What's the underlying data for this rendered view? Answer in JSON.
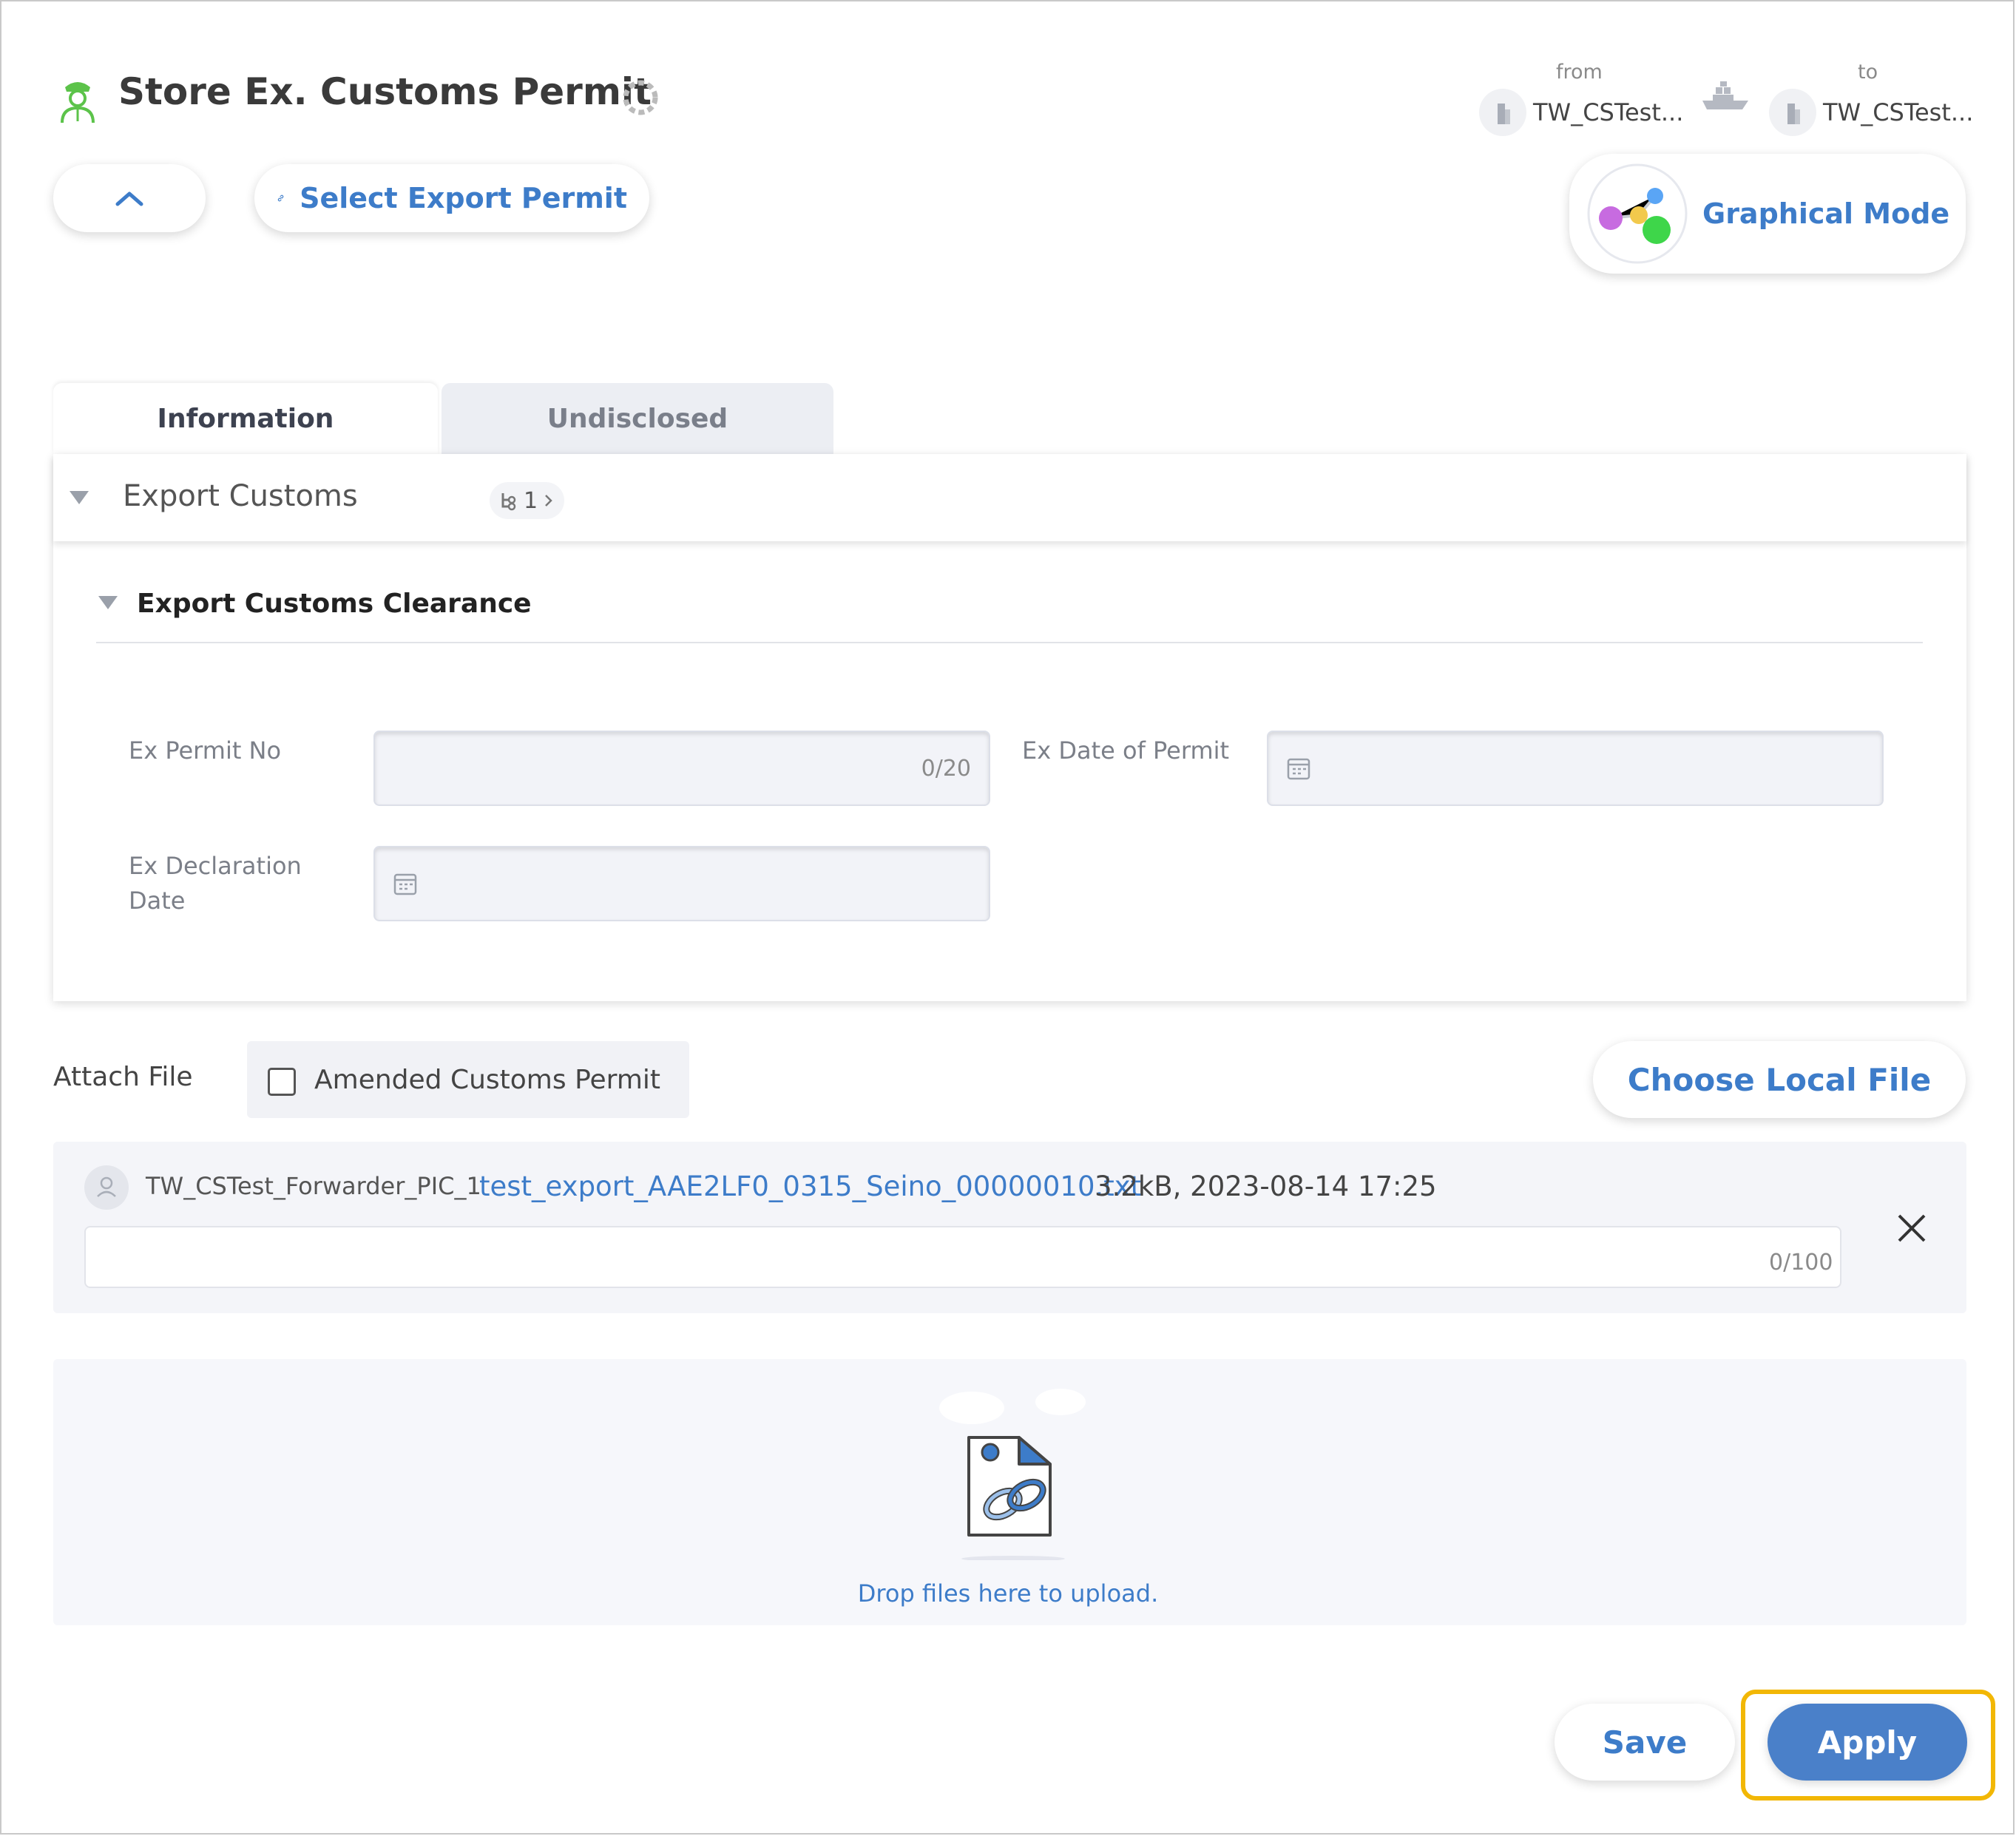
{
  "header": {
    "title": "Store Ex. Customs Permit",
    "route": {
      "from_label": "from",
      "from_name": "TW_CSTest...",
      "to_label": "to",
      "to_name": "TW_CSTest..."
    }
  },
  "toolbar": {
    "select_export_permit": "Select Export Permit",
    "graphical_mode": "Graphical Mode"
  },
  "tabs": [
    {
      "label": "Information",
      "active": true
    },
    {
      "label": "Undisclosed",
      "active": false
    }
  ],
  "section": {
    "title": "Export Customs",
    "badge_count": "1",
    "subsection_title": "Export Customs Clearance"
  },
  "fields": {
    "ex_permit_no": {
      "label": "Ex Permit No",
      "value": "",
      "counter": "0/20"
    },
    "ex_date_of_permit": {
      "label": "Ex Date of Permit",
      "value": ""
    },
    "ex_declaration_date": {
      "label_line1": "Ex Declaration",
      "label_line2": "Date",
      "value": ""
    }
  },
  "attachments": {
    "label": "Attach File",
    "amended_checkbox_label": "Amended Customs Permit",
    "amended_checked": false,
    "choose_local_file": "Choose Local File",
    "files": [
      {
        "uploader": "TW_CSTest_Forwarder_PIC_1",
        "filename": "test_export_AAE2LF0_0315_Seino_00000010.txt",
        "info": "3.2kB, 2023-08-14 17:25",
        "comment": "",
        "comment_counter": "0/100"
      }
    ],
    "drop_text": "Drop files here to upload."
  },
  "footer": {
    "save": "Save",
    "apply": "Apply"
  },
  "colors": {
    "accent": "#3d7cc9",
    "highlight": "#f2b705",
    "officer_icon": "#5cc34a"
  },
  "icons": [
    "customs-officer-icon",
    "loading-spinner-icon",
    "building-icon",
    "ship-icon",
    "chevron-up-icon",
    "link-icon",
    "graph-nodes-icon",
    "caret-down-icon",
    "hierarchy-icon",
    "chevron-right-icon",
    "calendar-icon",
    "user-avatar-icon",
    "close-icon",
    "file-link-icon",
    "cloud-icon"
  ]
}
